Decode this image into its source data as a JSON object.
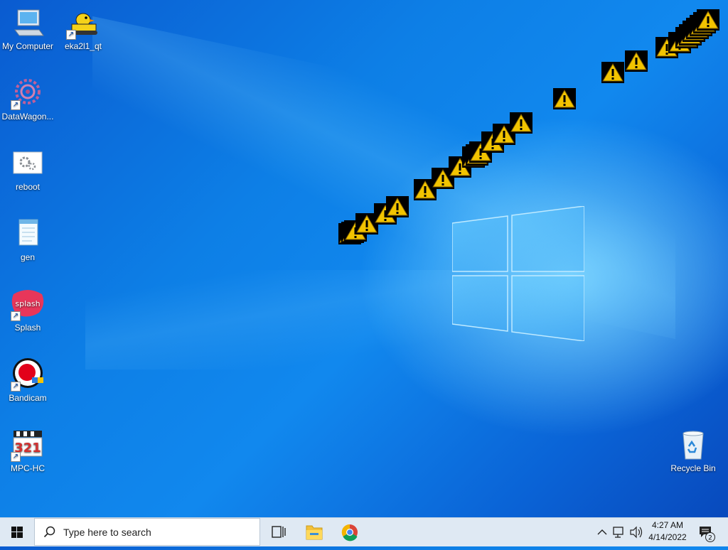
{
  "desktop": {
    "icons": [
      {
        "label": "My Computer",
        "icon": "computer-icon"
      },
      {
        "label": "eka2l1_qt",
        "icon": "duck-tank-icon"
      },
      {
        "label": "DataWagon...",
        "icon": "gear-cluster-icon"
      },
      {
        "label": "reboot",
        "icon": "gears-icon"
      },
      {
        "label": "gen",
        "icon": "notepad-icon"
      },
      {
        "label": "Splash",
        "icon": "splash-icon"
      },
      {
        "label": "Bandicam",
        "icon": "bandicam-icon"
      },
      {
        "label": "MPC-HC",
        "icon": "mpc-hc-icon"
      },
      {
        "label": "Recycle Bin",
        "icon": "recycle-bin-icon"
      }
    ],
    "splash_logo_text": "splash",
    "mpc_logo_text": "321",
    "warning_icon": "warning-icon"
  },
  "taskbar": {
    "search_placeholder": "Type here to search",
    "pinned": [
      "task-view-icon",
      "file-explorer-icon",
      "chrome-icon"
    ],
    "clock_time": "4:27 AM",
    "clock_date": "4/14/2022",
    "notification_count": "2"
  },
  "colors": {
    "taskbar_bg": "#dfe9f3",
    "desktop_blue": "#0d7fe6",
    "warning_yellow": "#f2c400"
  }
}
